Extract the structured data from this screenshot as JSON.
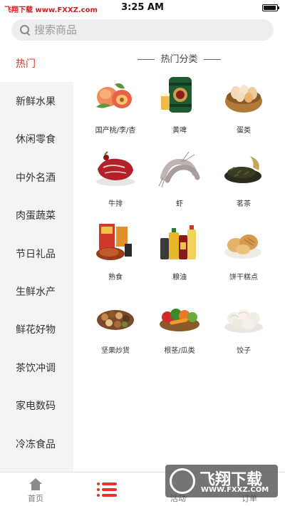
{
  "status_bar": {
    "left_text": "飞翔下载 www.FXXZ.com",
    "time": "3:25 AM"
  },
  "search": {
    "placeholder": "搜索商品"
  },
  "sidebar": {
    "items": [
      {
        "label": "热门",
        "active": true
      },
      {
        "label": "新鲜水果"
      },
      {
        "label": "休闲零食"
      },
      {
        "label": "中外名酒"
      },
      {
        "label": "肉蛋蔬菜"
      },
      {
        "label": "节日礼品"
      },
      {
        "label": "生鲜水产"
      },
      {
        "label": "鲜花好物"
      },
      {
        "label": "茶饮冲调"
      },
      {
        "label": "家电数码"
      },
      {
        "label": "冷冻食品"
      }
    ]
  },
  "main": {
    "section_title": "热门分类",
    "categories": [
      {
        "label": "国产桃/李/杏",
        "icon": "peach-icon"
      },
      {
        "label": "黄啤",
        "icon": "beer-keg-icon"
      },
      {
        "label": "蛋类",
        "icon": "eggs-basket-icon"
      },
      {
        "label": "牛排",
        "icon": "steak-icon"
      },
      {
        "label": "虾",
        "icon": "shrimp-icon"
      },
      {
        "label": "茗茶",
        "icon": "tea-leaves-icon"
      },
      {
        "label": "熟食",
        "icon": "roast-duck-icon"
      },
      {
        "label": "粮油",
        "icon": "oil-bottles-icon"
      },
      {
        "label": "饼干糕点",
        "icon": "pastry-icon"
      },
      {
        "label": "坚果炒货",
        "icon": "nuts-icon"
      },
      {
        "label": "根茎/瓜类",
        "icon": "vegetables-icon"
      },
      {
        "label": "饺子",
        "icon": "dumplings-icon"
      }
    ]
  },
  "tabbar": {
    "items": [
      {
        "label": "首页",
        "icon": "home-icon"
      },
      {
        "label": "",
        "icon": "category-list-icon",
        "active": true
      },
      {
        "label": "活动",
        "icon": "activity-icon"
      },
      {
        "label": "订单",
        "icon": "order-icon"
      }
    ]
  },
  "watermark": {
    "title": "飞翔下载",
    "url": "WWW.FXXZ.COM"
  },
  "colors": {
    "accent": "#e8322b",
    "sidebar_bg": "#f4f4f4",
    "search_bg": "#eeeeee"
  }
}
